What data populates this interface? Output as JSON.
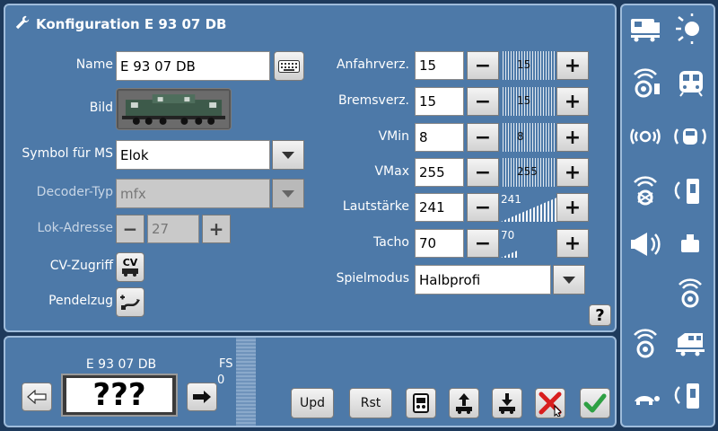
{
  "title": "Konfiguration E 93 07 DB",
  "left_form": {
    "name_label": "Name",
    "name_value": "E 93 07 DB",
    "bild_label": "Bild",
    "symbol_label": "Symbol für MS",
    "symbol_value": "Elok",
    "decoder_label": "Decoder-Typ",
    "decoder_value": "mfx",
    "address_label": "Lok-Adresse",
    "address_value": "27",
    "cv_label": "CV-Zugriff",
    "cv_button": "CV",
    "pendel_label": "Pendelzug"
  },
  "right_form": {
    "rows": [
      {
        "label": "Anfahrverz.",
        "value": "15",
        "meter": "15",
        "level": 0.06
      },
      {
        "label": "Bremsverz.",
        "value": "15",
        "meter": "15",
        "level": 0.06
      },
      {
        "label": "VMin",
        "value": "8",
        "meter": "8",
        "level": 0.03
      },
      {
        "label": "VMax",
        "value": "255",
        "meter": "255",
        "level": 1.0
      },
      {
        "label": "Lautstärke",
        "value": "241",
        "meter": "241",
        "level": 0.95
      },
      {
        "label": "Tacho",
        "value": "70",
        "meter": "70",
        "level": 0.27
      }
    ],
    "spielmodus_label": "Spielmodus",
    "spielmodus_value": "Halbprofi",
    "help_label": "?"
  },
  "loco": {
    "name": "E 93 07 DB",
    "display": "???",
    "fs_label": "FS",
    "fs_value": "0"
  },
  "bottom_buttons": {
    "upd": "Upd",
    "rst": "Rst"
  },
  "colors": {
    "panel": "#4d79a8",
    "border": "#9fbcdb",
    "background": "#1e3a5c",
    "ok": "#2ea043",
    "cancel": "#d81e1e"
  }
}
